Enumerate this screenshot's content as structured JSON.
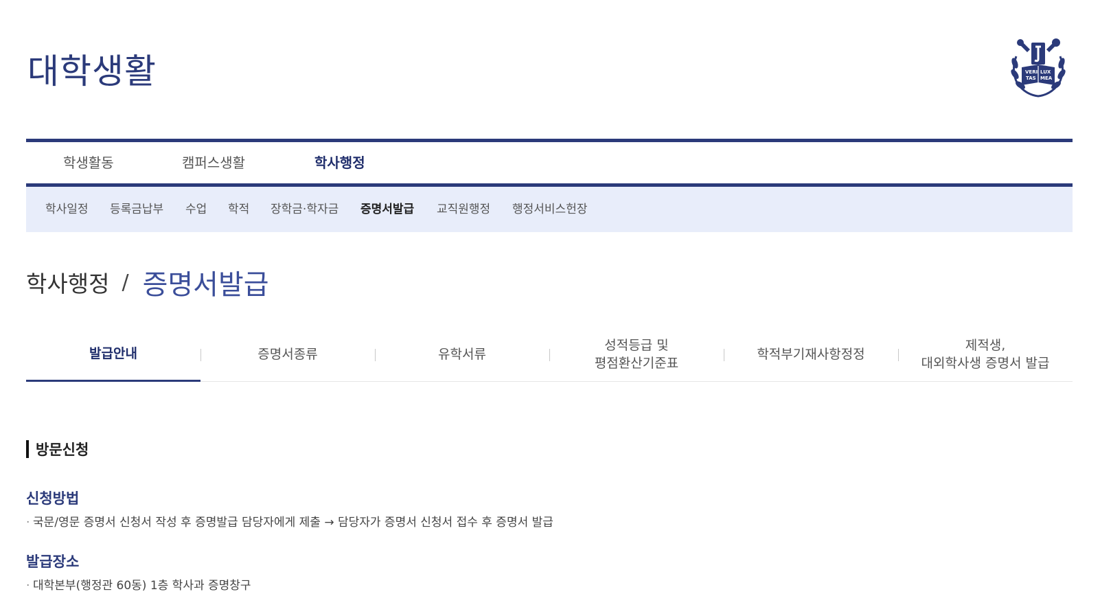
{
  "header": {
    "title": "대학생활",
    "logo_icon": "snu-emblem-icon",
    "logo_text": [
      "VERI",
      "LUX",
      "TAS",
      "MEA"
    ]
  },
  "main_nav": {
    "items": [
      {
        "label": "학생활동",
        "active": false
      },
      {
        "label": "캠퍼스생활",
        "active": false
      },
      {
        "label": "학사행정",
        "active": true
      }
    ]
  },
  "sub_nav": {
    "items": [
      {
        "label": "학사일정",
        "active": false
      },
      {
        "label": "등록금납부",
        "active": false
      },
      {
        "label": "수업",
        "active": false
      },
      {
        "label": "학적",
        "active": false
      },
      {
        "label": "장학금·학자금",
        "active": false
      },
      {
        "label": "증명서발급",
        "active": true
      },
      {
        "label": "교직원행정",
        "active": false
      },
      {
        "label": "행정서비스헌장",
        "active": false
      }
    ]
  },
  "breadcrumb": {
    "parent": "학사행정",
    "separator": "/",
    "current": "증명서발급"
  },
  "tabs": [
    {
      "lines": [
        "발급안내"
      ],
      "active": true
    },
    {
      "lines": [
        "증명서종류"
      ],
      "active": false
    },
    {
      "lines": [
        "유학서류"
      ],
      "active": false
    },
    {
      "lines": [
        "성적등급 및",
        "평점환산기준표"
      ],
      "active": false
    },
    {
      "lines": [
        "학적부기재사항정정"
      ],
      "active": false
    },
    {
      "lines": [
        "제적생,",
        "대외학사생 증명서 발급"
      ],
      "active": false
    }
  ],
  "content": {
    "section_title": "방문신청",
    "blocks": [
      {
        "heading": "신청방법",
        "bullet": "·",
        "text": "국문/영문 증명서 신청서 작성 후 증명발급 담당자에게 제출 → 담당자가 증명서 신청서 접수 후 증명서 발급"
      },
      {
        "heading": "발급장소",
        "bullet": "·",
        "text": "대학본부(행정관 60동) 1층 학사과 증명창구"
      }
    ]
  },
  "colors": {
    "brand_navy": "#2b3a7a",
    "subnav_bg": "#e8edfa",
    "breadcrumb_current": "#3b4e9a"
  }
}
